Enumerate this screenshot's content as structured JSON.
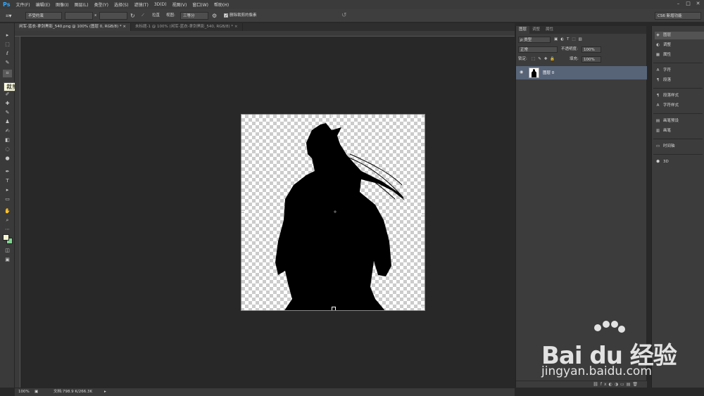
{
  "app": {
    "logo": "Ps"
  },
  "menu": [
    "文件(F)",
    "编辑(E)",
    "图像(I)",
    "图层(L)",
    "类型(Y)",
    "选择(S)",
    "滤镜(T)",
    "3D(D)",
    "视图(V)",
    "窗口(W)",
    "帮助(H)"
  ],
  "window_controls": [
    "–",
    "□",
    "✕"
  ],
  "options": {
    "ratio_select": "不受约束",
    "x_separator": "x",
    "straighten_label": "拉直",
    "view_label": "视图:",
    "view_select": "三等分",
    "delete_pixels_label": "删除裁剪的像素",
    "workspace": "CS6 新增功能"
  },
  "tabs": [
    {
      "label": "闲军-蓝衣-拿剑黑影_540.png @ 100% (图层 0, RGB/8) *",
      "active": true
    },
    {
      "label": "未标题-1 @ 100% (闲军-蓝衣-拿剑黑影_540, RGB/8) *",
      "active": false
    }
  ],
  "tooltip": "裁剪工具 (C)",
  "tools": [
    "▸",
    "⬚",
    "ℓ",
    "✎",
    "⌗",
    "✐",
    "✚",
    "✎",
    "♟",
    "✍",
    "◧",
    "◌",
    "●",
    "✒",
    "T",
    "▸",
    "▭",
    "✋",
    "⌕",
    "⋯"
  ],
  "colors": {
    "foreground": "#f4f4d0",
    "background": "#7fd48f",
    "selected_layer": "#576478",
    "accent": "#31a8ff"
  },
  "status": {
    "zoom": "100%",
    "doc": "文档:798.9 K/266.3K"
  },
  "layers_panel": {
    "tabs": [
      {
        "label": "图层",
        "active": true
      },
      {
        "label": "调整",
        "active": false
      },
      {
        "label": "属性",
        "active": false
      }
    ],
    "kind_filter": "ρ 类型",
    "blend_mode": "正常",
    "opacity_label": "不透明度:",
    "opacity_value": "100%",
    "lock_label": "锁定:",
    "fill_label": "填充:",
    "fill_value": "100%",
    "layers": [
      {
        "name": "图层 0",
        "visible": true,
        "selected": true
      }
    ]
  },
  "dock": [
    {
      "icon": "layers-icon",
      "glyph": "◈",
      "label": "图层",
      "active": true
    },
    {
      "icon": "adjust-icon",
      "glyph": "◐",
      "label": "调整",
      "active": false
    },
    {
      "icon": "properties-icon",
      "glyph": "▦",
      "label": "属性",
      "active": false
    },
    {
      "icon": "character-icon",
      "glyph": "A",
      "label": "字符",
      "active": false
    },
    {
      "icon": "paragraph-icon",
      "glyph": "¶",
      "label": "段落",
      "active": false
    },
    {
      "icon": "paragraph-style-icon",
      "glyph": "¶",
      "label": "段落样式",
      "active": false
    },
    {
      "icon": "character-style-icon",
      "glyph": "A",
      "label": "字符样式",
      "active": false
    },
    {
      "icon": "brush-preset-icon",
      "glyph": "▤",
      "label": "画笔预设",
      "active": false
    },
    {
      "icon": "brush-icon",
      "glyph": "▥",
      "label": "画笔",
      "active": false
    },
    {
      "icon": "timeline-icon",
      "glyph": "▭",
      "label": "时间轴",
      "active": false
    },
    {
      "icon": "3d-icon",
      "glyph": "⬢",
      "label": "3D",
      "active": false
    }
  ],
  "watermark": {
    "brand": "Bai du 经验",
    "url": "jingyan.baidu.com"
  }
}
